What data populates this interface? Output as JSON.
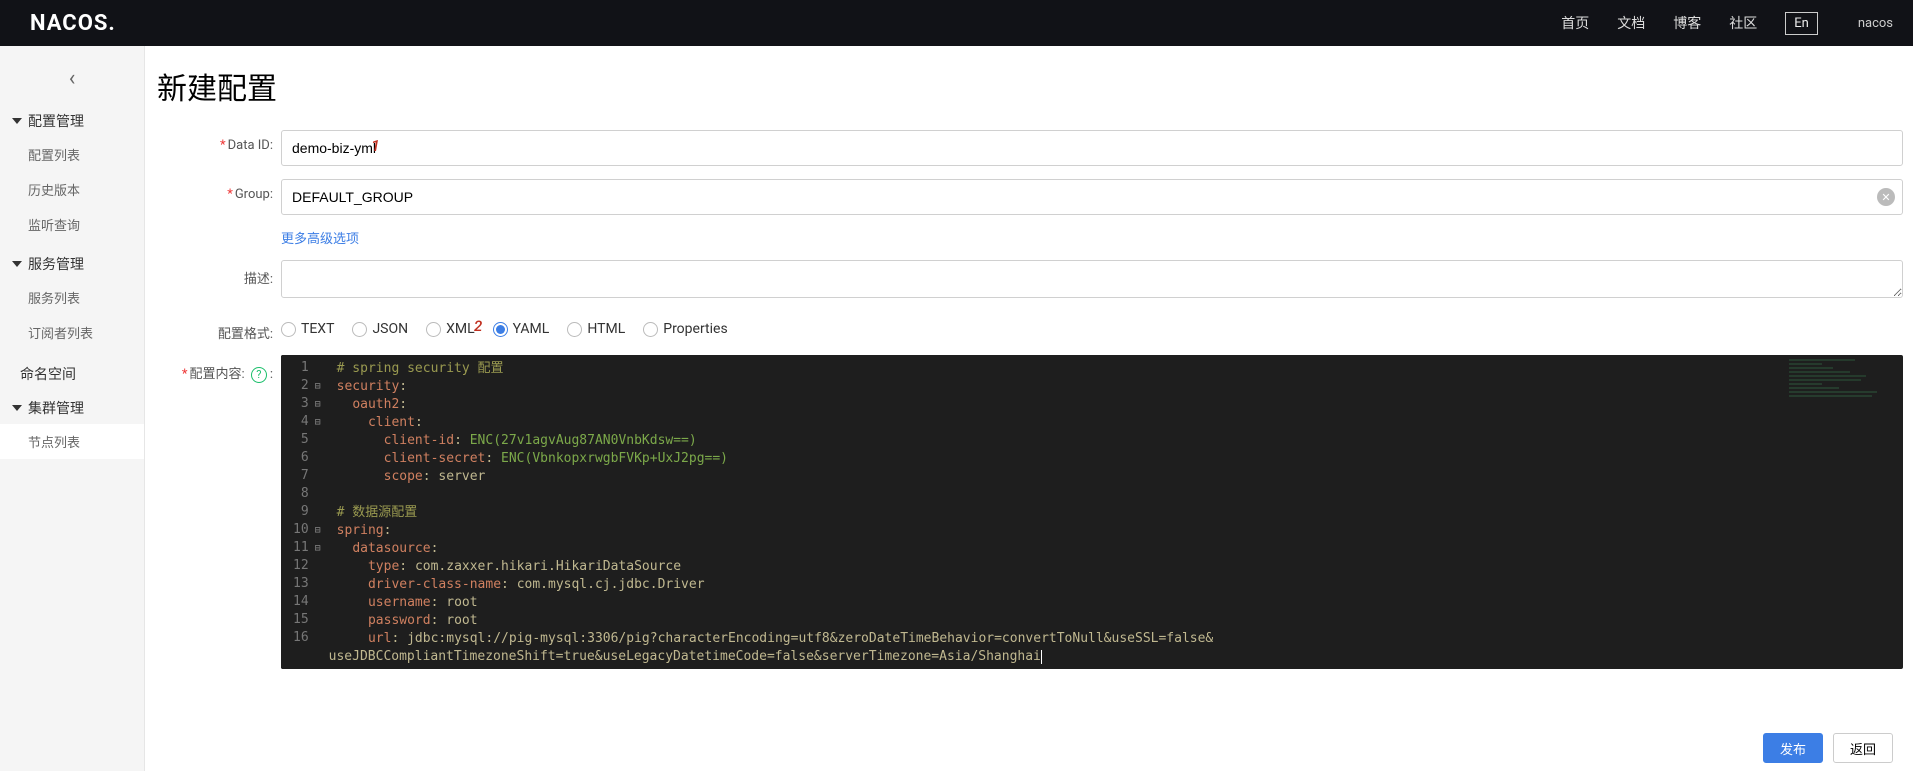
{
  "header": {
    "logo": "NACOS.",
    "nav": {
      "home": "首页",
      "docs": "文档",
      "blog": "博客",
      "community": "社区"
    },
    "lang": "En",
    "user": "nacos"
  },
  "sidebar": {
    "back_icon": "‹",
    "groups": {
      "config": {
        "title": "配置管理",
        "items": {
          "list": "配置列表",
          "history": "历史版本",
          "listen": "监听查询"
        }
      },
      "service": {
        "title": "服务管理",
        "items": {
          "list": "服务列表",
          "subs": "订阅者列表"
        }
      },
      "cluster": {
        "title": "集群管理",
        "items": {
          "nodes": "节点列表"
        }
      }
    },
    "namespace": "命名空间"
  },
  "page": {
    "title": "新建配置",
    "labels": {
      "dataId": "Data ID:",
      "group": "Group:",
      "more": "更多高级选项",
      "desc": "描述:",
      "format": "配置格式:",
      "content_prefix": "配置内容:"
    },
    "fields": {
      "dataId": "demo-biz-yml",
      "group": "DEFAULT_GROUP",
      "desc": ""
    },
    "annotations": {
      "one": "1",
      "two": "2"
    },
    "formats": {
      "text": "TEXT",
      "json": "JSON",
      "xml": "XML",
      "yaml": "YAML",
      "html": "HTML",
      "properties": "Properties",
      "selected": "yaml"
    },
    "editor": {
      "lines": [
        {
          "n": 1,
          "fold": "",
          "seg": [
            {
              "c": "c-comment",
              "t": "# spring security 配置"
            }
          ]
        },
        {
          "n": 2,
          "fold": "⊟",
          "seg": [
            {
              "c": "c-key",
              "t": "security"
            },
            {
              "c": "c-punc",
              "t": ":"
            }
          ]
        },
        {
          "n": 3,
          "fold": "⊟",
          "seg": [
            {
              "c": "",
              "t": "  "
            },
            {
              "c": "c-key",
              "t": "oauth2"
            },
            {
              "c": "c-punc",
              "t": ":"
            }
          ]
        },
        {
          "n": 4,
          "fold": "⊟",
          "seg": [
            {
              "c": "",
              "t": "    "
            },
            {
              "c": "c-key",
              "t": "client"
            },
            {
              "c": "c-punc",
              "t": ":"
            }
          ]
        },
        {
          "n": 5,
          "fold": "",
          "seg": [
            {
              "c": "",
              "t": "      "
            },
            {
              "c": "c-key",
              "t": "client-id"
            },
            {
              "c": "c-punc",
              "t": ": "
            },
            {
              "c": "c-str",
              "t": "ENC(27v1agvAug87AN0VnbKdsw==)"
            }
          ]
        },
        {
          "n": 6,
          "fold": "",
          "seg": [
            {
              "c": "",
              "t": "      "
            },
            {
              "c": "c-key",
              "t": "client-secret"
            },
            {
              "c": "c-punc",
              "t": ": "
            },
            {
              "c": "c-str",
              "t": "ENC(VbnkopxrwgbFVKp+UxJ2pg==)"
            }
          ]
        },
        {
          "n": 7,
          "fold": "",
          "seg": [
            {
              "c": "",
              "t": "      "
            },
            {
              "c": "c-key",
              "t": "scope"
            },
            {
              "c": "c-punc",
              "t": ": "
            },
            {
              "c": "c-ident",
              "t": "server"
            }
          ]
        },
        {
          "n": 8,
          "fold": "",
          "seg": [
            {
              "c": "",
              "t": ""
            }
          ]
        },
        {
          "n": 9,
          "fold": "",
          "seg": [
            {
              "c": "c-comment",
              "t": "# 数据源配置"
            }
          ]
        },
        {
          "n": 10,
          "fold": "⊟",
          "seg": [
            {
              "c": "c-key",
              "t": "spring"
            },
            {
              "c": "c-punc",
              "t": ":"
            }
          ]
        },
        {
          "n": 11,
          "fold": "⊟",
          "seg": [
            {
              "c": "",
              "t": "  "
            },
            {
              "c": "c-key",
              "t": "datasource"
            },
            {
              "c": "c-punc",
              "t": ":"
            }
          ]
        },
        {
          "n": 12,
          "fold": "",
          "seg": [
            {
              "c": "",
              "t": "    "
            },
            {
              "c": "c-key",
              "t": "type"
            },
            {
              "c": "c-punc",
              "t": ": "
            },
            {
              "c": "c-ident",
              "t": "com.zaxxer.hikari.HikariDataSource"
            }
          ]
        },
        {
          "n": 13,
          "fold": "",
          "seg": [
            {
              "c": "",
              "t": "    "
            },
            {
              "c": "c-key",
              "t": "driver-class-name"
            },
            {
              "c": "c-punc",
              "t": ": "
            },
            {
              "c": "c-ident",
              "t": "com.mysql.cj.jdbc.Driver"
            }
          ]
        },
        {
          "n": 14,
          "fold": "",
          "seg": [
            {
              "c": "",
              "t": "    "
            },
            {
              "c": "c-key",
              "t": "username"
            },
            {
              "c": "c-punc",
              "t": ": "
            },
            {
              "c": "c-ident",
              "t": "root"
            }
          ]
        },
        {
          "n": 15,
          "fold": "",
          "seg": [
            {
              "c": "",
              "t": "    "
            },
            {
              "c": "c-key",
              "t": "password"
            },
            {
              "c": "c-punc",
              "t": ": "
            },
            {
              "c": "c-ident",
              "t": "root"
            }
          ]
        },
        {
          "n": 16,
          "fold": "",
          "seg": [
            {
              "c": "",
              "t": "    "
            },
            {
              "c": "c-key",
              "t": "url"
            },
            {
              "c": "c-punc",
              "t": ": "
            },
            {
              "c": "c-ident",
              "t": "jdbc:mysql://pig-mysql:3306/pig?characterEncoding=utf8&zeroDateTimeBehavior=convertToNull&useSSL=false&"
            }
          ]
        },
        {
          "n": "",
          "fold": "",
          "seg": [
            {
              "c": "c-ident",
              "t": "useJDBCCompliantTimezoneShift=true&useLegacyDatetimeCode=false&serverTimezone=Asia/Shanghai"
            }
          ],
          "cursor": true,
          "noindent": true
        }
      ]
    }
  },
  "footer": {
    "publish": "发布",
    "back": "返回"
  }
}
